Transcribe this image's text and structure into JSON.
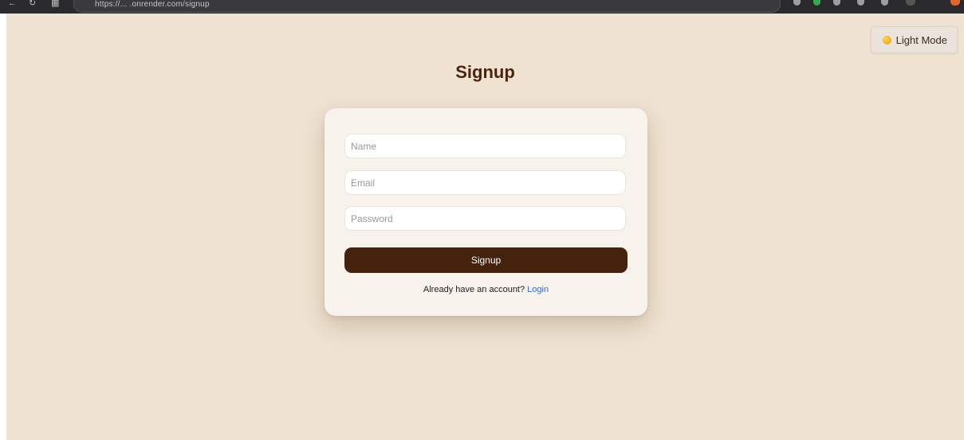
{
  "browser": {
    "url": "https://...  .onrender.com/signup",
    "nav_icons": [
      "back-icon",
      "reload-icon",
      "apps-icon"
    ],
    "extension_icons": [
      "extension-icon",
      "extension-icon",
      "extension-icon",
      "extension-icon",
      "extension-icon",
      "profile-icon"
    ]
  },
  "theme_toggle": {
    "icon": "sun-icon",
    "label": "Light Mode",
    "icon_color": "#f4b41a"
  },
  "page": {
    "title": "Signup",
    "background": "#efe2d0"
  },
  "form": {
    "name_placeholder": "Name",
    "email_placeholder": "Email",
    "password_placeholder": "Password",
    "submit_label": "Signup",
    "submit_color": "#45220e",
    "login_prompt": "Already have an account?",
    "login_link": "Login",
    "link_color": "#3b6fd4"
  }
}
